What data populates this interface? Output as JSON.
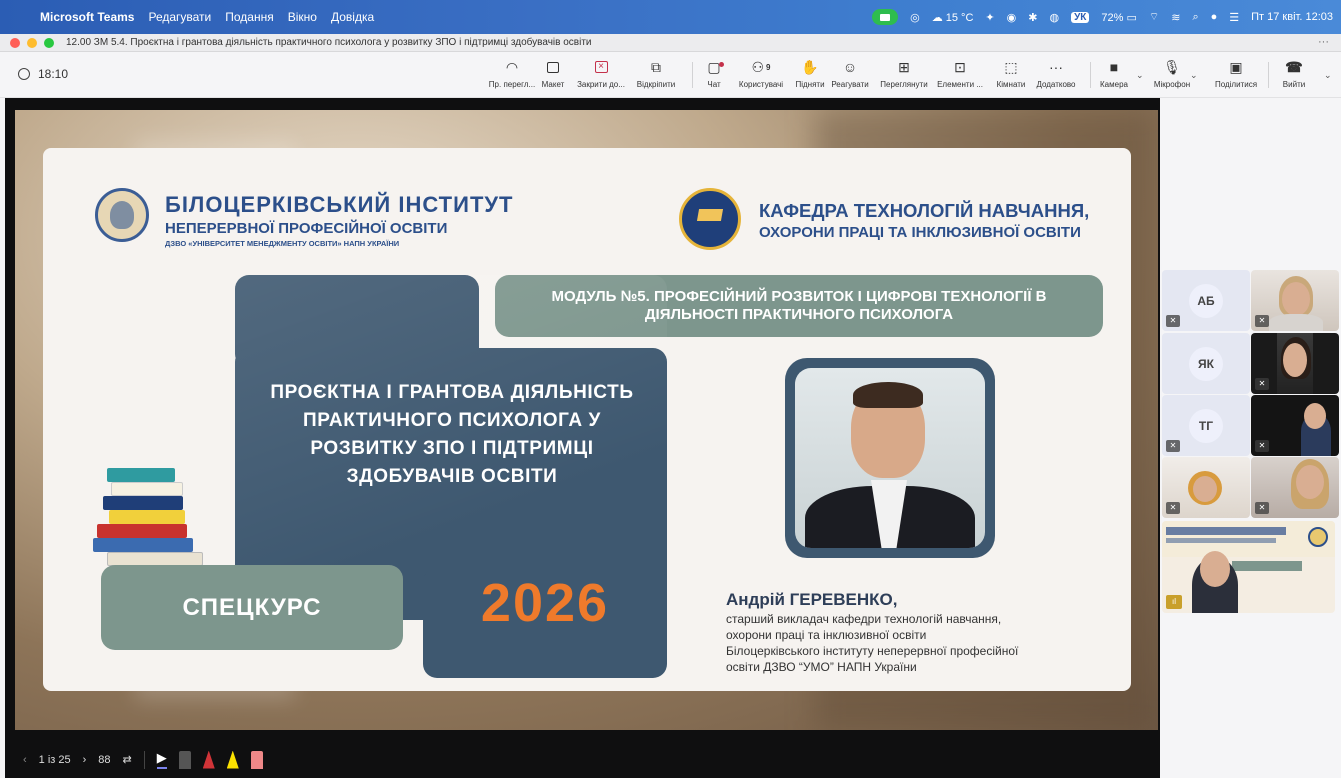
{
  "menubar": {
    "app": "Microsoft Teams",
    "items": [
      "Редагувати",
      "Подання",
      "Вікно",
      "Довідка"
    ],
    "weather": "15 °C",
    "lang": "УК",
    "battery": "72%",
    "datetime": "Пт 17 квіт. 12:03"
  },
  "window": {
    "title": "12.00 ЗМ 5.4. Проєктна і грантова діяльність практичного психолога у розвитку ЗПО і підтримці здобувачів освіти",
    "more": "···"
  },
  "toolbar": {
    "timer": "18:10",
    "buttons": [
      {
        "label": "Пр. перегл...",
        "icon": "immersive-view-icon"
      },
      {
        "label": "Макет",
        "icon": "layout-icon"
      },
      {
        "label": "Закрити до...",
        "icon": "close-share-icon"
      },
      {
        "label": "Відкріпити",
        "icon": "popout-icon"
      },
      {
        "label": "Чат",
        "icon": "chat-icon"
      },
      {
        "label": "Користувачі",
        "icon": "people-icon",
        "count": "9"
      },
      {
        "label": "Підняти",
        "icon": "raise-hand-icon"
      },
      {
        "label": "Реагувати",
        "icon": "react-icon"
      },
      {
        "label": "Переглянути",
        "icon": "view-icon"
      },
      {
        "label": "Елементи ...",
        "icon": "apps-icon"
      },
      {
        "label": "Кімнати",
        "icon": "rooms-icon"
      },
      {
        "label": "Додатково",
        "icon": "more-icon",
        "glyph": "···"
      },
      {
        "label": "Камера",
        "icon": "camera-icon"
      },
      {
        "label": "Мікрофон",
        "icon": "microphone-icon"
      },
      {
        "label": "Поділитися",
        "icon": "share-icon"
      },
      {
        "label": "Вийти",
        "icon": "leave-icon"
      }
    ]
  },
  "slide": {
    "institute": {
      "name": "БІЛОЦЕРКІВСЬКИЙ ІНСТИТУТ",
      "sub": "НЕПЕРЕРВНОЇ ПРОФЕСІЙНОЇ ОСВІТИ",
      "small": "ДЗВО «УНІВЕРСИТЕТ МЕНЕДЖМЕНТУ ОСВІТИ» НАПН УКРАЇНИ"
    },
    "department": {
      "line1": "КАФЕДРА ТЕХНОЛОГІЙ НАВЧАННЯ,",
      "line2": "ОХОРОНИ ПРАЦІ ТА ІНКЛЮЗИВНОЇ ОСВІТИ"
    },
    "module": "МОДУЛЬ №5. ПРОФЕСІЙНИЙ РОЗВИТОК І ЦИФРОВІ ТЕХНОЛОГІЇ В ДІЯЛЬНОСТІ ПРАКТИЧНОГО ПСИХОЛОГА",
    "title_lines": [
      "ПРОЄКТНА І ГРАНТОВА ДІЯЛЬНІСТЬ",
      "ПРАКТИЧНОГО ПСИХОЛОГА У",
      "РОЗВИТКУ ЗПО І ПІДТРИМЦІ",
      "ЗДОБУВАЧІВ ОСВІТИ"
    ],
    "course": "СПЕЦКУРС",
    "year": "2026",
    "speaker": {
      "name": "Андрій ГЕРЕВЕНКО,",
      "lines": [
        "старший викладач кафедри технологій навчання,",
        "охорони праці та інклюзивної освіти",
        " Білоцерківського інституту неперервної професійної",
        "освіти ДЗВО “УМО” НАПН України"
      ]
    }
  },
  "presenter_bar": {
    "page": "1 із 25",
    "prev": "‹",
    "next": "›",
    "grid": "88"
  },
  "participants": [
    {
      "initials": "АБ",
      "muted": true
    },
    {
      "initials": "ЯК",
      "muted": false
    },
    {
      "initials": "ТГ",
      "muted": true
    }
  ]
}
